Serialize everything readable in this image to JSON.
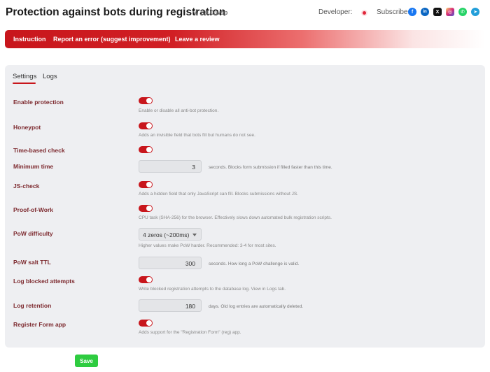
{
  "header": {
    "title": "Protection against bots during registration",
    "version": "v. 1.0.0.wsp",
    "developer_label": "Developer:",
    "subscribe_label": "Subscribe:",
    "social_icons": [
      {
        "name": "facebook-icon",
        "glyph": "f",
        "color": "#1877f2"
      },
      {
        "name": "linkedin-icon",
        "glyph": "in",
        "color": "#0a66c2"
      },
      {
        "name": "x-icon",
        "glyph": "X",
        "color": "#111111"
      },
      {
        "name": "instagram-icon",
        "glyph": "◎",
        "color": "#d62976"
      },
      {
        "name": "whatsapp-icon",
        "glyph": "✆",
        "color": "#25d366"
      },
      {
        "name": "telegram-icon",
        "glyph": "➤",
        "color": "#229ed9"
      }
    ]
  },
  "nav": {
    "instruction": "Instruction",
    "report": "Report an error (suggest improvement)",
    "review": "Leave a review"
  },
  "tabs": {
    "settings": "Settings",
    "logs": "Logs"
  },
  "settings": {
    "enable_protection": {
      "label": "Enable protection",
      "enabled": true,
      "desc": "Enable or disable all anti-bot protection."
    },
    "honeypot": {
      "label": "Honeypot",
      "enabled": true,
      "desc": "Adds an invisible field that bots fill but humans do not see."
    },
    "time_based": {
      "label": "Time-based check",
      "enabled": true
    },
    "minimum_time": {
      "label": "Minimum time",
      "value": "3",
      "desc": "seconds. Blocks form submission if filled faster than this time."
    },
    "js_check": {
      "label": "JS-check",
      "enabled": true,
      "desc": "Adds a hidden field that only JavaScript can fill. Blocks submissions without JS."
    },
    "pow": {
      "label": "Proof-of-Work",
      "enabled": true,
      "desc": "CPU task (SHA-256) for the browser. Effectively slows down automated bulk registration scripts."
    },
    "pow_difficulty": {
      "label": "PoW difficulty",
      "selected": "4 zeros (~200ms)",
      "desc": "Higher values make PoW harder. Recommended: 3-4 for most sites."
    },
    "pow_salt_ttl": {
      "label": "PoW salt TTL",
      "value": "300",
      "desc": "seconds. How long a PoW challenge is valid."
    },
    "log_blocked": {
      "label": "Log blocked attempts",
      "enabled": true,
      "desc": "Write blocked registration attempts to the database log. View in Logs tab."
    },
    "log_retention": {
      "label": "Log retention",
      "value": "180",
      "desc": "days. Old log entries are automatically deleted."
    },
    "register_form": {
      "label": "Register Form app",
      "enabled": true,
      "desc": "Adds support for the \"Registration Form\" (reg) app."
    }
  },
  "save_label": "Save",
  "colors": {
    "accent": "#c8161c",
    "save": "#2ecc40",
    "label": "#7d2a2f"
  }
}
